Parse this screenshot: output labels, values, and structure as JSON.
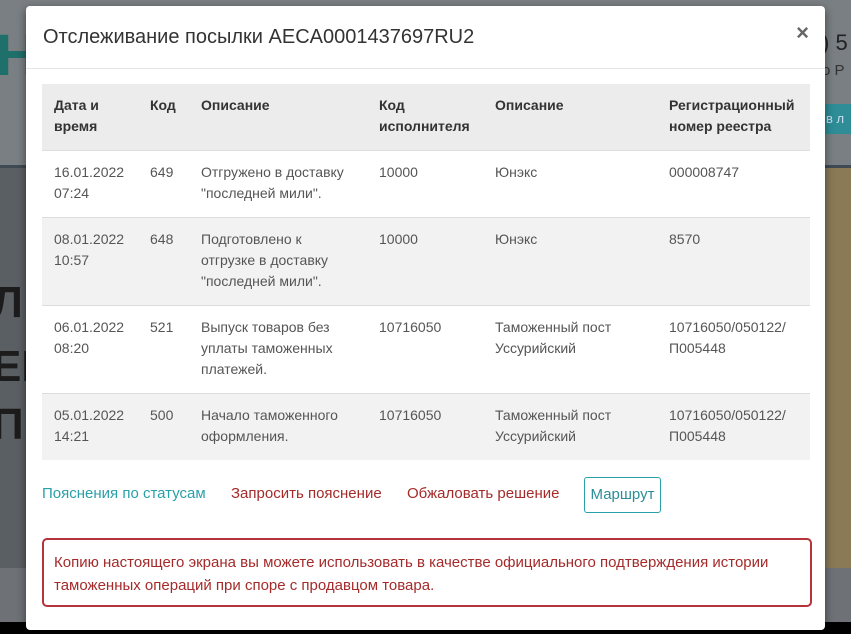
{
  "modal": {
    "title": "Отслеживание посылки AECA0001437697RU2",
    "close": "×"
  },
  "table": {
    "headers": [
      "Дата и время",
      "Код",
      "Описание",
      "Код исполнителя",
      "Описание",
      "Регистрационный номер реестра"
    ],
    "rows": [
      [
        "16.01.2022 07:24",
        "649",
        "Отгружено в доставку \"последней мили\".",
        "10000",
        "Юнэкс",
        "000008747"
      ],
      [
        "08.01.2022 10:57",
        "648",
        "Подготовлено к отгрузке в доставку \"последней мили\".",
        "10000",
        "Юнэкс",
        "8570"
      ],
      [
        "06.01.2022 08:20",
        "521",
        "Выпуск товаров без уплаты таможенных платежей.",
        "10716050",
        "Таможенный пост Уссурийский",
        "10716050/050122/П005448"
      ],
      [
        "05.01.2022 14:21",
        "500",
        "Начало таможенного оформления.",
        "10716050",
        "Таможенный пост Уссурийский",
        "10716050/050122/П005448"
      ]
    ]
  },
  "links": {
    "status_help": "Пояснения по статусам",
    "request_explanation": "Запросить пояснение",
    "appeal": "Обжаловать решение",
    "route": "Маршрут"
  },
  "notice": "Копию настоящего экрана вы можете использовать в качестве официального подтверждения истории таможенных операций при споре с продавцом товара.",
  "background": {
    "logo_fragment": "Н",
    "phone_fragment": ") 5",
    "sub_fragment": "о Р",
    "button_fragment": "в л",
    "hero_fragments": [
      "Л",
      "ЕР",
      "П"
    ]
  },
  "colors": {
    "link_teal": "#2aa0a8",
    "link_red": "#a52a2a",
    "notice_border": "#b5333b"
  }
}
